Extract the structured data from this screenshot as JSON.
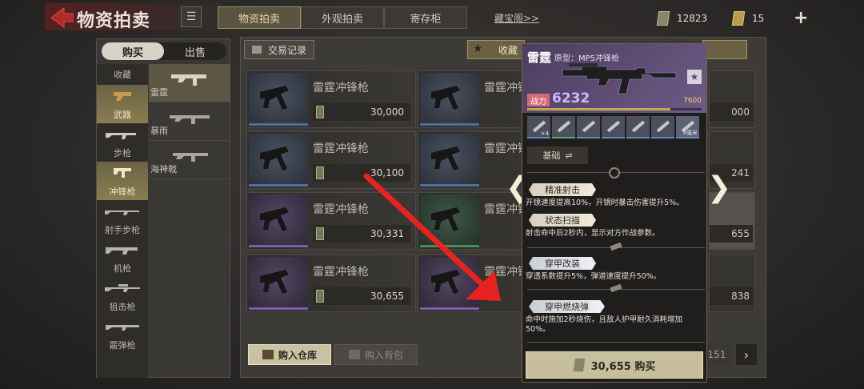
{
  "header": {
    "title": "物资拍卖",
    "menu_icon": "list-icon",
    "tabs": [
      {
        "label": "物资拍卖",
        "active": true
      },
      {
        "label": "外观拍卖",
        "active": false
      },
      {
        "label": "寄存柜",
        "active": false
      }
    ],
    "treasure_link": "藏宝阁>>",
    "currency_silver": "12823",
    "currency_gold": "15",
    "plus_label": "+"
  },
  "side": {
    "buy_label": "购买",
    "sell_label": "出售",
    "categories": [
      {
        "label": "收藏",
        "active": false
      },
      {
        "label": "武器",
        "active": true
      },
      {
        "label": "步枪",
        "active": false
      },
      {
        "label": "冲锋枪",
        "active": true
      },
      {
        "label": "射手步枪",
        "active": false
      },
      {
        "label": "机枪",
        "active": false
      },
      {
        "label": "狙击枪",
        "active": false
      },
      {
        "label": "霰弹枪",
        "active": false
      }
    ],
    "subitems": [
      {
        "label": "雷霆",
        "active": true
      },
      {
        "label": "暴雨",
        "active": false
      },
      {
        "label": "海神戟",
        "active": false
      }
    ]
  },
  "main": {
    "trade_record": "交易记录",
    "favorite": "收藏",
    "cards": [
      {
        "name": "雷霆冲锋枪",
        "price": "30,000",
        "rarity": "blue"
      },
      {
        "name": "雷霆冲锋枪",
        "price": "",
        "rarity": "blue"
      },
      {
        "name": "雷霆冲锋枪",
        "price": "30,100",
        "rarity": "blue"
      },
      {
        "name": "雷霆冲锋枪",
        "price": "",
        "rarity": "blue"
      },
      {
        "name": "雷霆冲锋枪",
        "price": "30,331",
        "rarity": "purple"
      },
      {
        "name": "雷霆冲锋枪",
        "price": "",
        "rarity": "green"
      },
      {
        "name": "雷霆冲锋枪",
        "price": "30,655",
        "rarity": "purple"
      },
      {
        "name": "雷霆冲锋枪",
        "price": "",
        "rarity": "purple"
      }
    ],
    "right_prices": [
      "000",
      "241",
      "655",
      "838"
    ],
    "buy_to_warehouse": "购入仓库",
    "buy_to_backpack": "购入背包",
    "page_number": "151"
  },
  "detail": {
    "name": "雷霆",
    "prototype": "原型：MP5冲锋枪",
    "power_label": "战力",
    "power_value": "6232",
    "power_max": "7600",
    "power_ratio": 0.82,
    "attach_count": "×4",
    "attach_last": "9毫米",
    "base_label": "基础",
    "perks": [
      {
        "title": "精准射击",
        "desc": "开镜速度提高10%，开镜时暴击伤害提升5%。"
      },
      {
        "title": "状态扫描",
        "desc": "射击命中后2秒内，显示对方作战参数。"
      },
      {
        "title": "穿甲改装",
        "desc": "穿透系数提升5%，弹道速度提升50%。"
      },
      {
        "title": "穿甲燃烧弹",
        "desc": "命中时施加2秒烧伤，且敌人护甲耐久消耗增加50%。"
      }
    ],
    "buy_label": "30,655 购买",
    "left_chevron": "❮",
    "right_chevron": "❯"
  },
  "colors": {
    "accent_gold": "#c7be9d",
    "rarity_blue": "#4f6fa0",
    "rarity_purple": "#7a5fa8",
    "rarity_green": "#4d8a55",
    "power_purple": "#d3b6ff",
    "arrow_red": "#e8231f"
  }
}
